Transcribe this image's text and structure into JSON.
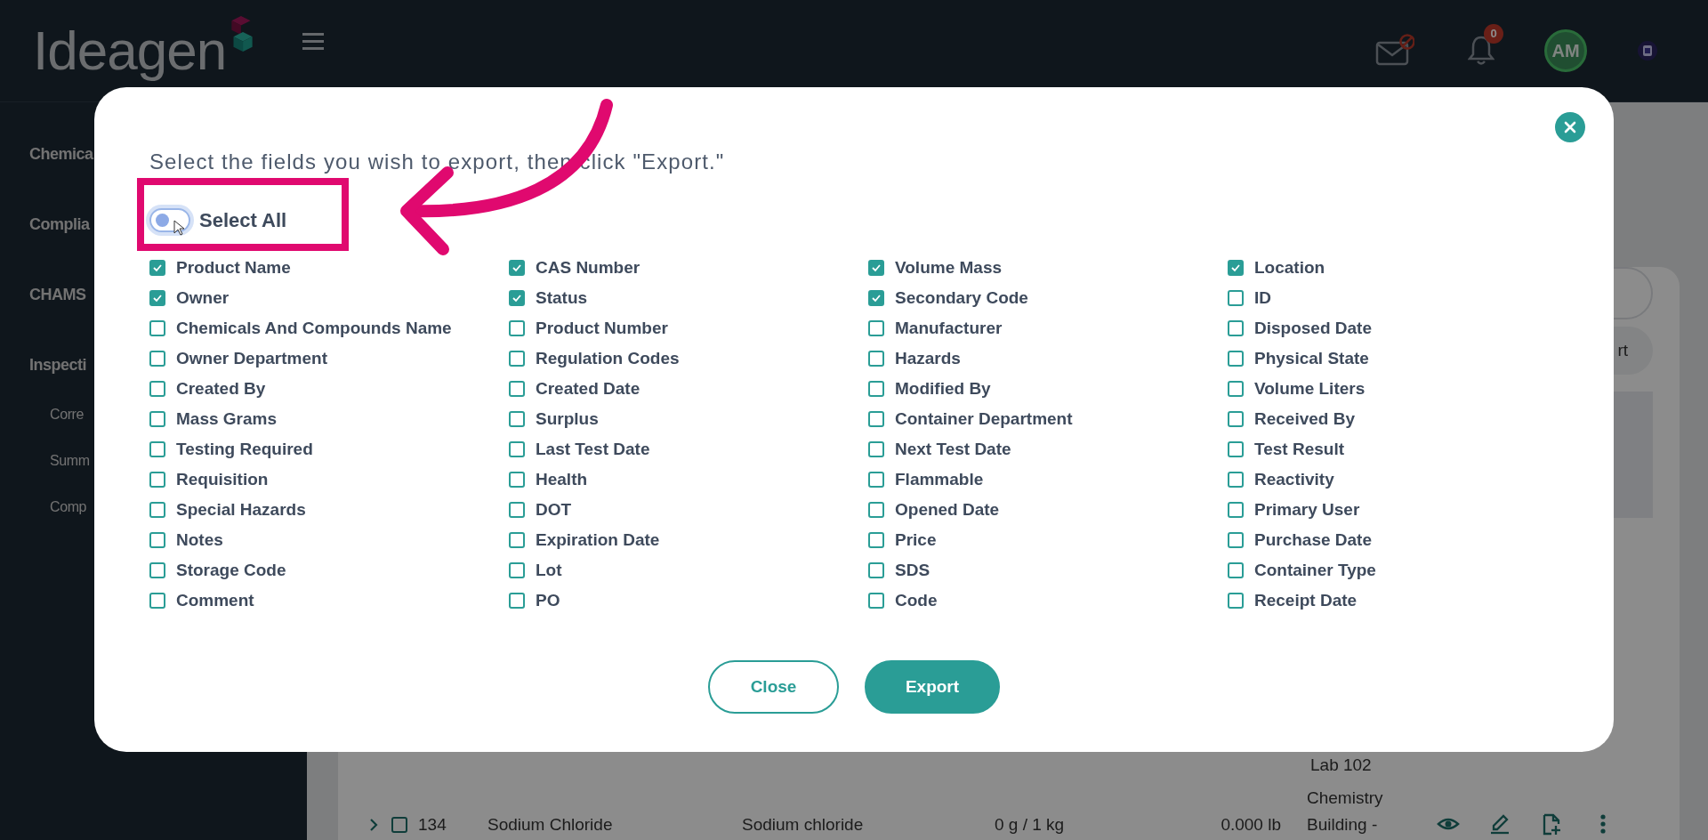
{
  "header": {
    "logo": "Ideagen",
    "notification_count": "0",
    "avatar_initials": "AM"
  },
  "sidebar": {
    "items": [
      {
        "label": "Chemica"
      },
      {
        "label": "Complia"
      },
      {
        "label": "CHAMS"
      },
      {
        "label": "Inspecti",
        "children": [
          {
            "label": "Corre"
          },
          {
            "label": "Summ"
          },
          {
            "label": "Comp"
          }
        ]
      }
    ]
  },
  "background_toolbar": {
    "button_label": "rt"
  },
  "background_table": {
    "rows": [
      {
        "kind": "tail",
        "cells": [
          "",
          "",
          "",
          "",
          "",
          "Lab 102"
        ]
      },
      {
        "kind": "item",
        "expanded": false,
        "checked": false,
        "cells": [
          "134",
          "Sodium Chloride",
          "Sodium chloride",
          "0 g / 1 kg",
          "0.000 lb",
          "Chemistry Building -"
        ]
      }
    ]
  },
  "modal": {
    "title": "Select the fields you wish to export, then click \"Export.\"",
    "select_all": {
      "label": "Select All",
      "on": false
    },
    "field_columns": [
      [
        {
          "label": "Product Name",
          "checked": true
        },
        {
          "label": "Owner",
          "checked": true
        },
        {
          "label": "Chemicals And Compounds Name",
          "checked": false
        },
        {
          "label": "Owner Department",
          "checked": false
        },
        {
          "label": "Created By",
          "checked": false
        },
        {
          "label": "Mass Grams",
          "checked": false
        },
        {
          "label": "Testing Required",
          "checked": false
        },
        {
          "label": "Requisition",
          "checked": false
        },
        {
          "label": "Special Hazards",
          "checked": false
        },
        {
          "label": "Notes",
          "checked": false
        },
        {
          "label": "Storage Code",
          "checked": false
        },
        {
          "label": "Comment",
          "checked": false
        }
      ],
      [
        {
          "label": "CAS Number",
          "checked": true
        },
        {
          "label": "Status",
          "checked": true
        },
        {
          "label": "Product Number",
          "checked": false
        },
        {
          "label": "Regulation Codes",
          "checked": false
        },
        {
          "label": "Created Date",
          "checked": false
        },
        {
          "label": "Surplus",
          "checked": false
        },
        {
          "label": "Last Test Date",
          "checked": false
        },
        {
          "label": "Health",
          "checked": false
        },
        {
          "label": "DOT",
          "checked": false
        },
        {
          "label": "Expiration Date",
          "checked": false
        },
        {
          "label": "Lot",
          "checked": false
        },
        {
          "label": "PO",
          "checked": false
        }
      ],
      [
        {
          "label": "Volume Mass",
          "checked": true
        },
        {
          "label": "Secondary Code",
          "checked": true
        },
        {
          "label": "Manufacturer",
          "checked": false
        },
        {
          "label": "Hazards",
          "checked": false
        },
        {
          "label": "Modified By",
          "checked": false
        },
        {
          "label": "Container Department",
          "checked": false
        },
        {
          "label": "Next Test Date",
          "checked": false
        },
        {
          "label": "Flammable",
          "checked": false
        },
        {
          "label": "Opened Date",
          "checked": false
        },
        {
          "label": "Price",
          "checked": false
        },
        {
          "label": "SDS",
          "checked": false
        },
        {
          "label": "Code",
          "checked": false
        }
      ],
      [
        {
          "label": "Location",
          "checked": true
        },
        {
          "label": "ID",
          "checked": false
        },
        {
          "label": "Disposed Date",
          "checked": false
        },
        {
          "label": "Physical State",
          "checked": false
        },
        {
          "label": "Volume Liters",
          "checked": false
        },
        {
          "label": "Received By",
          "checked": false
        },
        {
          "label": "Test Result",
          "checked": false
        },
        {
          "label": "Reactivity",
          "checked": false
        },
        {
          "label": "Primary User",
          "checked": false
        },
        {
          "label": "Purchase Date",
          "checked": false
        },
        {
          "label": "Container Type",
          "checked": false
        },
        {
          "label": "Receipt Date",
          "checked": false
        }
      ]
    ],
    "buttons": [
      {
        "label": "Close",
        "kind": "outline"
      },
      {
        "label": "Export",
        "kind": "primary"
      }
    ]
  }
}
